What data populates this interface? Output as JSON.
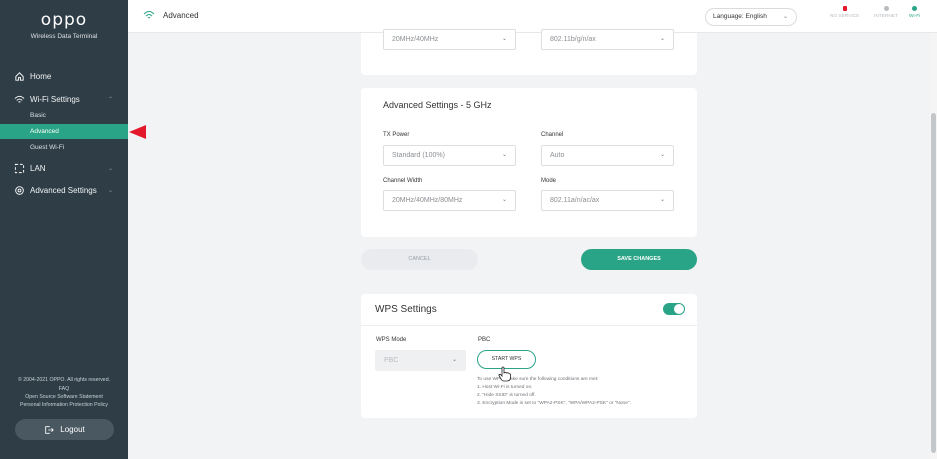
{
  "sidebar": {
    "brand": "oppo",
    "brand_sub": "Wireless Data Terminal",
    "nav": {
      "home": "Home",
      "wifi_settings": "Wi-Fi Settings",
      "basic": "Basic",
      "advanced": "Advanced",
      "guest_wifi": "Guest Wi-Fi",
      "lan": "LAN",
      "advanced_settings": "Advanced Settings"
    },
    "footer": {
      "copyright": "© 2004-2021 OPPO. All rights reserved.",
      "faq": "FAQ",
      "oss": "Open Source Software Statement",
      "privacy": "Personal Information Protection Policy"
    },
    "logout": "Logout"
  },
  "header": {
    "title": "Advanced",
    "language_label": "Language:",
    "language_value": "English",
    "status": {
      "no_service": "NO SERVICE",
      "internet": "INTERNET",
      "wifi": "Wi-Fi"
    }
  },
  "top_card": {
    "bandwidth_value": "20MHz/40MHz",
    "mode_value": "802.11b/g/n/ax"
  },
  "advanced_5ghz": {
    "title": "Advanced Settings - 5 GHz",
    "tx_power_label": "TX Power",
    "tx_power_value": "Standard (100%)",
    "channel_label": "Channel",
    "channel_value": "Auto",
    "channel_width_label": "Channel Width",
    "channel_width_value": "20MHz/40MHz/80MHz",
    "mode_label": "Mode",
    "mode_value": "802.11a/n/ac/ax"
  },
  "actions": {
    "cancel": "CANCEL",
    "save": "SAVE CHANGES"
  },
  "wps": {
    "title": "WPS Settings",
    "enabled": true,
    "mode_label": "WPS Mode",
    "mode_value": "PBC",
    "pbc_label": "PBC",
    "start_button": "START WPS",
    "notes": [
      "To use WPS, make sure the following conditions are met:",
      "1. Host Wi-Fi is turned on.",
      "2. \"Hide SSID\" is turned off.",
      "3. Encryption Mode is set to \"WPA2-PSK\", \"WPA/WPA2-PSK\" or \"None\"."
    ]
  },
  "colors": {
    "accent": "#2aa486",
    "sidebar_bg": "#2f3d46",
    "pointer": "#e3182b"
  }
}
